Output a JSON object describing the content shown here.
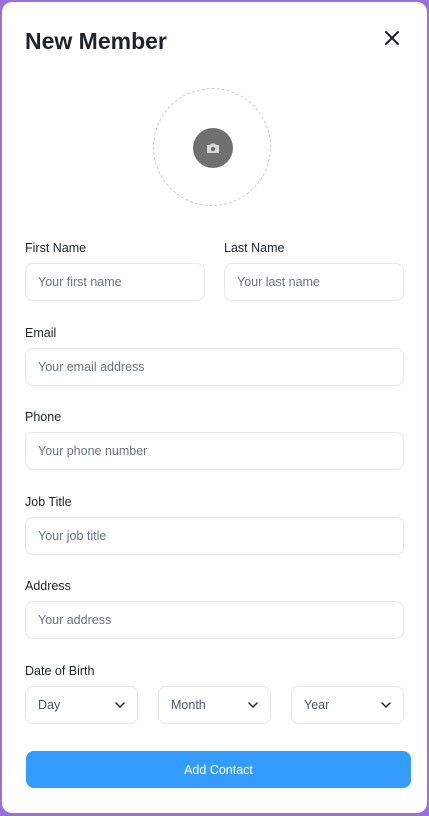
{
  "modal": {
    "title": "New Member"
  },
  "form": {
    "first_name": {
      "label": "First Name",
      "placeholder": "Your first name",
      "value": ""
    },
    "last_name": {
      "label": "Last Name",
      "placeholder": "Your last name",
      "value": ""
    },
    "email": {
      "label": "Email",
      "placeholder": "Your email address",
      "value": ""
    },
    "phone": {
      "label": "Phone",
      "placeholder": "Your phone number",
      "value": ""
    },
    "job_title": {
      "label": "Job Title",
      "placeholder": "Your job title",
      "value": ""
    },
    "address": {
      "label": "Address",
      "placeholder": "Your address",
      "value": ""
    },
    "dob": {
      "label": "Date of Birth",
      "day": "Day",
      "month": "Month",
      "year": "Year"
    },
    "submit_label": "Add Contact"
  },
  "icons": {
    "close": "close-icon",
    "camera": "camera-icon",
    "chevron": "chevron-down-icon"
  },
  "colors": {
    "accent": "#349cff",
    "frame": "#9b6fdc",
    "camera_bg": "#707070"
  }
}
